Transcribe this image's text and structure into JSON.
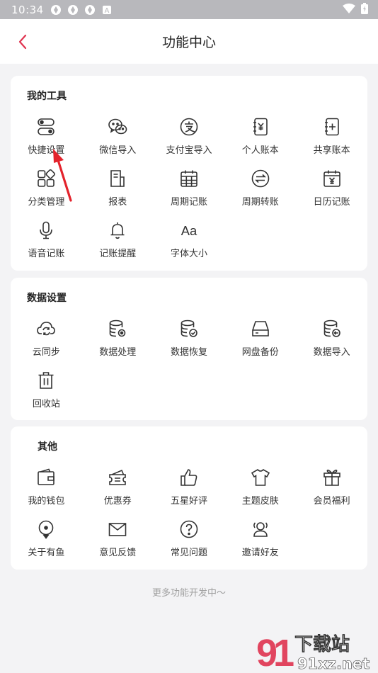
{
  "status_bar": {
    "time": "10:34",
    "notification_icons": [
      "app-icon",
      "app-icon",
      "app-icon",
      "a-icon"
    ],
    "signal_icons": [
      "wifi-icon",
      "battery-icon"
    ]
  },
  "header": {
    "title": "功能中心",
    "back_icon": "chevron-left-icon"
  },
  "sections": {
    "tools": {
      "title": "我的工具",
      "items": [
        {
          "label": "快捷设置",
          "icon": "toggle-icon"
        },
        {
          "label": "微信导入",
          "icon": "wechat-icon"
        },
        {
          "label": "支付宝导入",
          "icon": "alipay-icon"
        },
        {
          "label": "个人账本",
          "icon": "yen-book-icon"
        },
        {
          "label": "共享账本",
          "icon": "plus-book-icon"
        },
        {
          "label": "分类管理",
          "icon": "category-icon"
        },
        {
          "label": "报表",
          "icon": "report-icon"
        },
        {
          "label": "周期记账",
          "icon": "calendar-grid-icon"
        },
        {
          "label": "周期转账",
          "icon": "transfer-icon"
        },
        {
          "label": "日历记账",
          "icon": "calendar-yen-icon"
        },
        {
          "label": "语音记账",
          "icon": "microphone-icon"
        },
        {
          "label": "记账提醒",
          "icon": "bell-icon"
        },
        {
          "label": "字体大小",
          "icon": "font-size-icon"
        }
      ]
    },
    "data": {
      "title": "数据设置",
      "items": [
        {
          "label": "云同步",
          "icon": "cloud-sync-icon"
        },
        {
          "label": "数据处理",
          "icon": "database-gear-icon"
        },
        {
          "label": "数据恢复",
          "icon": "database-check-icon"
        },
        {
          "label": "网盘备份",
          "icon": "drive-icon"
        },
        {
          "label": "数据导入",
          "icon": "database-import-icon"
        },
        {
          "label": "回收站",
          "icon": "trash-icon"
        }
      ]
    },
    "other": {
      "title": "其他",
      "items": [
        {
          "label": "我的钱包",
          "icon": "wallet-icon"
        },
        {
          "label": "优惠券",
          "icon": "coupon-icon"
        },
        {
          "label": "五星好评",
          "icon": "thumbs-up-icon"
        },
        {
          "label": "主题皮肤",
          "icon": "tshirt-icon"
        },
        {
          "label": "会员福利",
          "icon": "gift-icon"
        },
        {
          "label": "关于有鱼",
          "icon": "location-pin-icon"
        },
        {
          "label": "意见反馈",
          "icon": "mail-icon"
        },
        {
          "label": "常见问题",
          "icon": "question-icon"
        },
        {
          "label": "邀请好友",
          "icon": "invite-friends-icon"
        }
      ]
    }
  },
  "footer_note": "更多功能开发中～",
  "watermark": {
    "brand": "下载站",
    "domain": "91xz.net"
  },
  "colors": {
    "accent": "#e0334f",
    "annotation_arrow": "#e3232c"
  }
}
